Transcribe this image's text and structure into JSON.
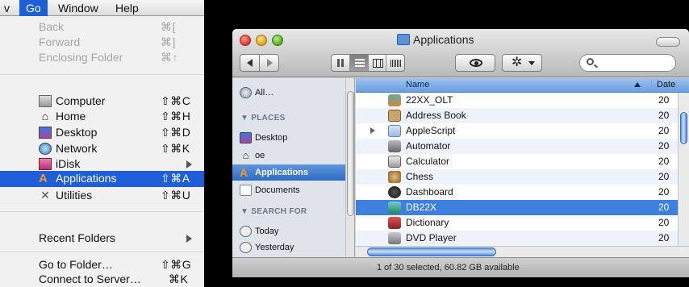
{
  "menubar": {
    "partial": "v",
    "go": "Go",
    "window": "Window",
    "help": "Help"
  },
  "go_menu": {
    "items": [
      {
        "label": "Back",
        "shortcut": "⌘["
      },
      {
        "label": "Forward",
        "shortcut": "⌘]"
      },
      {
        "label": "Enclosing Folder",
        "shortcut": "⌘↑"
      },
      {
        "label": "Computer",
        "shortcut": "⇧⌘C",
        "icon": "computer-icon"
      },
      {
        "label": "Home",
        "shortcut": "⇧⌘H",
        "icon": "home-icon"
      },
      {
        "label": "Desktop",
        "shortcut": "⇧⌘D",
        "icon": "desktop-icon"
      },
      {
        "label": "Network",
        "shortcut": "⇧⌘K",
        "icon": "network-icon"
      },
      {
        "label": "iDisk",
        "icon": "idisk-icon"
      },
      {
        "label": "Applications",
        "shortcut": "⇧⌘A",
        "icon": "applications-icon"
      },
      {
        "label": "Utilities",
        "shortcut": "⇧⌘U",
        "icon": "utilities-icon"
      },
      {
        "label": "Recent Folders"
      },
      {
        "label": "Go to Folder…",
        "shortcut": "⇧⌘G"
      },
      {
        "label": "Connect to Server…",
        "shortcut": "⌘K"
      }
    ]
  },
  "finder": {
    "title": "Applications",
    "sidebar": {
      "all": "All…",
      "places_header": "▼ PLACES",
      "places": [
        "Desktop",
        "oe",
        "Applications",
        "Documents"
      ],
      "search_header": "▼ SEARCH FOR",
      "search": [
        "Today",
        "Yesterday"
      ]
    },
    "columns": {
      "name": "Name",
      "date": "Date"
    },
    "rows": [
      {
        "name": "22XX_OLT",
        "date": "20"
      },
      {
        "name": "Address Book",
        "date": "20"
      },
      {
        "name": "AppleScript",
        "date": "20"
      },
      {
        "name": "Automator",
        "date": "20"
      },
      {
        "name": "Calculator",
        "date": "20"
      },
      {
        "name": "Chess",
        "date": "20"
      },
      {
        "name": "Dashboard",
        "date": "20"
      },
      {
        "name": "DB22X",
        "date": "20"
      },
      {
        "name": "Dictionary",
        "date": "20"
      },
      {
        "name": "DVD Player",
        "date": "20"
      }
    ],
    "status": "1 of 30 selected, 60.82 GB available"
  },
  "colors": {
    "accent": "#1f5ed9",
    "selection": "#3d80df"
  }
}
